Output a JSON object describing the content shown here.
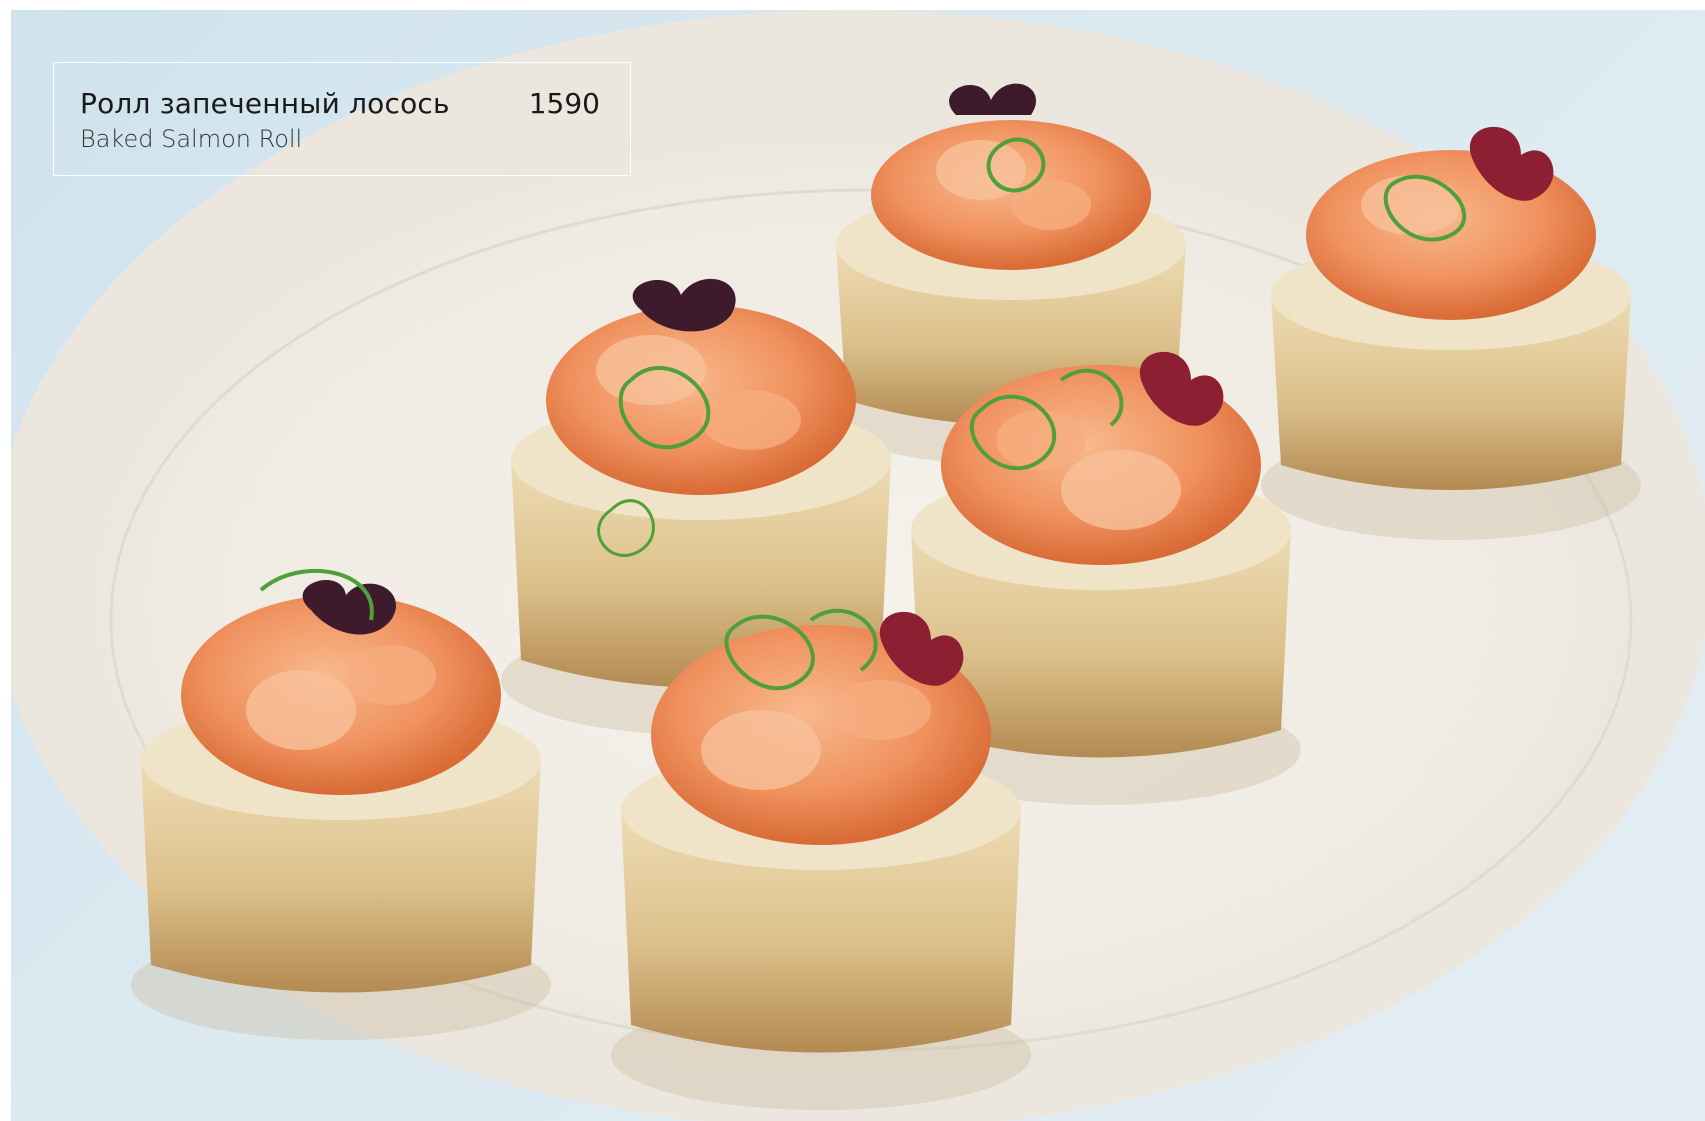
{
  "menu_item": {
    "name_ru": "Ролл запеченный лосось",
    "name_en": "Baked Salmon Roll",
    "price": "1590"
  },
  "photo": {
    "subject": "baked-salmon-roll-pieces",
    "piece_count": 6,
    "colors": {
      "background": "#dbe9f0",
      "plate": "#f3f0ea",
      "salmon": "#f29a6a",
      "rice_crust": "#e8d2a4",
      "garnish_leaf": "#4a1e33",
      "garnish_sprout": "#4fa03a"
    }
  }
}
